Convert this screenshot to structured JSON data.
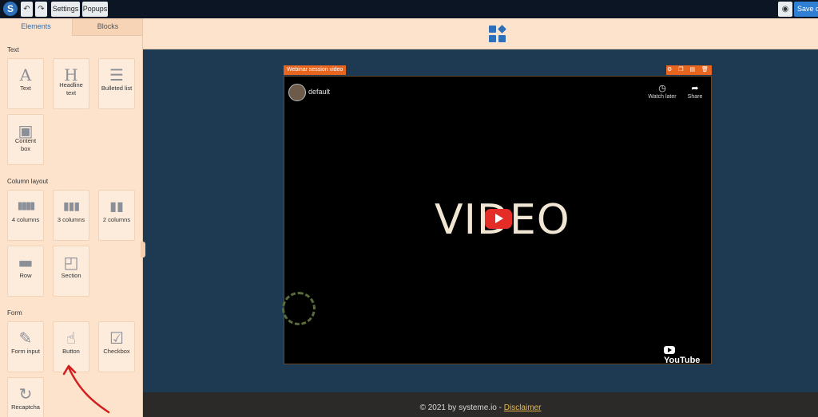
{
  "toolbar": {
    "logo": "S",
    "undo": "↶",
    "redo": "↷",
    "settings_label": "Settings",
    "popups_label": "Popups",
    "preview": "◉",
    "save_label": "Save ch"
  },
  "sidebar": {
    "tabs": [
      "Elements",
      "Blocks"
    ],
    "sections": {
      "text": "Text",
      "column_layout": "Column layout",
      "form": "Form"
    },
    "tiles": {
      "text": {
        "icon": "A",
        "label": "Text"
      },
      "headline": {
        "icon": "H",
        "label": "Headline text"
      },
      "bulleted": {
        "icon": "☰",
        "label": "Bulleted list"
      },
      "content_box": {
        "icon": "▣",
        "label": "Content box"
      },
      "four_col": {
        "icon": "▮▮▮▮",
        "label": "4 columns"
      },
      "three_col": {
        "icon": "▮▮▮",
        "label": "3 columns"
      },
      "two_col": {
        "icon": "▮▮",
        "label": "2 columns"
      },
      "row": {
        "icon": "▬",
        "label": "Row"
      },
      "section": {
        "icon": "◰",
        "label": "Section"
      },
      "form_input": {
        "icon": "✎",
        "label": "Form input"
      },
      "button": {
        "icon": "☝",
        "label": "Button"
      },
      "checkbox": {
        "icon": "☑",
        "label": "Checkbox"
      },
      "recaptcha": {
        "icon": "↻",
        "label": "Recaptcha"
      }
    }
  },
  "video_block": {
    "tag": "Webinar session video",
    "tools": "⚙ ❐ ▤ 🗑",
    "channel": "default",
    "watch_later": {
      "icon": "◷",
      "label": "Watch later"
    },
    "share": {
      "icon": "➦",
      "label": "Share"
    },
    "title": "VIDEO",
    "brand": "YouTube"
  },
  "footer": {
    "text": "© 2021 by systeme.io - ",
    "link": "Disclaimer"
  },
  "colors": {
    "accent": "#2d6fb8",
    "sidebar_bg": "#fde3cc",
    "canvas_bg": "#1e3a52",
    "tag_orange": "#e8651f",
    "annotation_red": "#d11f1f"
  }
}
